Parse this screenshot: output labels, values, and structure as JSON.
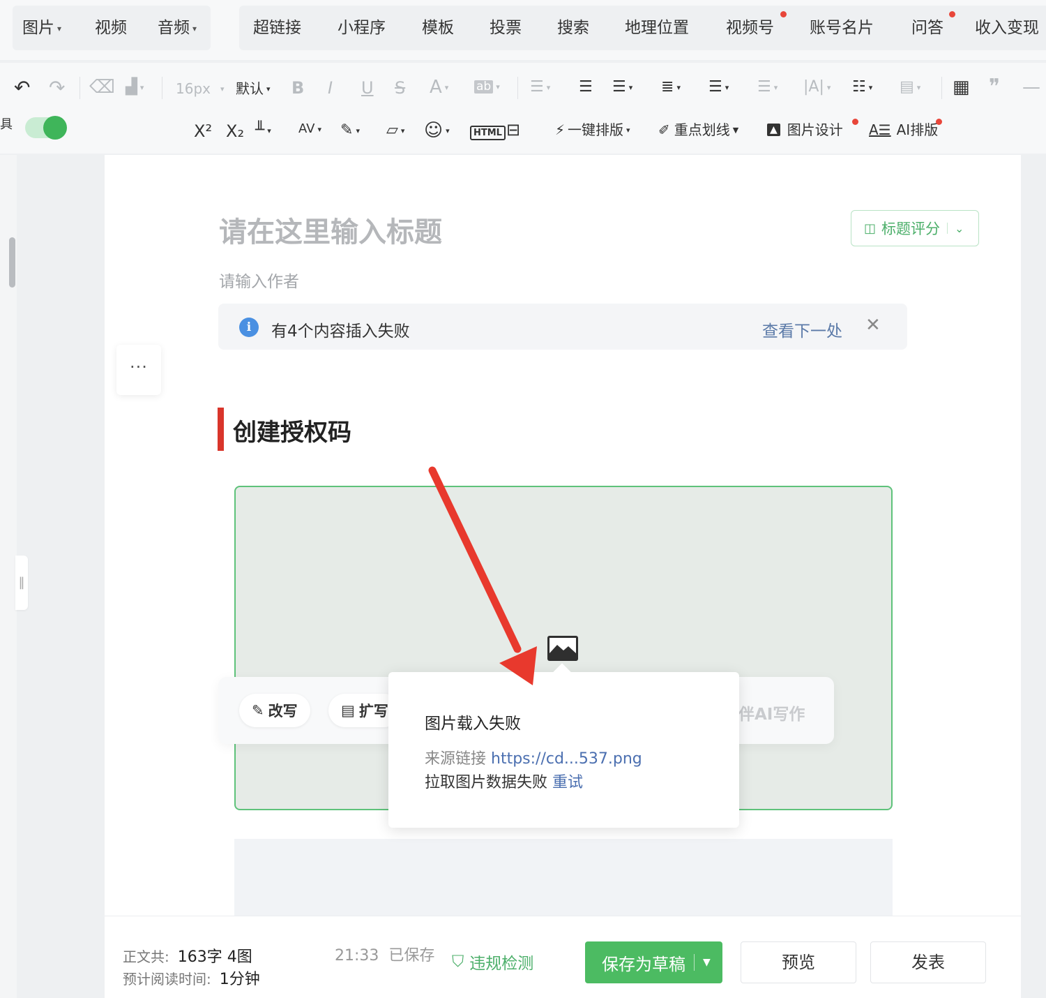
{
  "insert_bar": {
    "group1": [
      {
        "label": "图片",
        "has_caret": true
      },
      {
        "label": "视频",
        "has_caret": false
      },
      {
        "label": "音频",
        "has_caret": true
      }
    ],
    "group2": [
      {
        "label": "超链接"
      },
      {
        "label": "小程序"
      },
      {
        "label": "模板"
      },
      {
        "label": "投票"
      },
      {
        "label": "搜索"
      },
      {
        "label": "地理位置"
      },
      {
        "label": "视频号",
        "badge": true
      },
      {
        "label": "账号名片"
      },
      {
        "label": "问答",
        "badge": true
      },
      {
        "label": "收入变现"
      }
    ]
  },
  "toolbar": {
    "font_size": "16px",
    "font_family": "默认",
    "quick_format": "一键排版",
    "highlight_line": "重点划线",
    "image_design": "图片设计",
    "ai_format": "AI排版",
    "html_label": "HTML",
    "ab_label": "ab",
    "toggle_on": true
  },
  "editor": {
    "title_placeholder": "请在这里输入标题",
    "title_score": "标题评分",
    "author_placeholder": "请输入作者",
    "notice": {
      "message": "有4个内容插入失败",
      "next": "查看下一处"
    },
    "heading": "创建授权码",
    "more_label": "···",
    "ai_bar": {
      "rewrite": "改写",
      "expand": "扩写",
      "companion": "伴AI写作"
    },
    "popup": {
      "title": "图片载入失败",
      "source_label": "来源链接",
      "source_link": "https://cd...537.png",
      "error_text": "拉取图片数据失败",
      "retry": "重试"
    }
  },
  "footer": {
    "word_label": "正文共:",
    "word_value": "163字 4图",
    "read_label": "预计阅读时间:",
    "read_value": "1分钟",
    "save_time": "21:33",
    "save_status": "已保存",
    "check_label": "违规检测",
    "save_draft": "保存为草稿",
    "preview": "预览",
    "publish": "发表"
  },
  "colors": {
    "accent_green": "#4cbb62",
    "heading_bar": "#d9352b",
    "link_blue": "#4b6fb0",
    "annotation_arrow": "#e8392d",
    "badge_red": "#e8463a"
  }
}
